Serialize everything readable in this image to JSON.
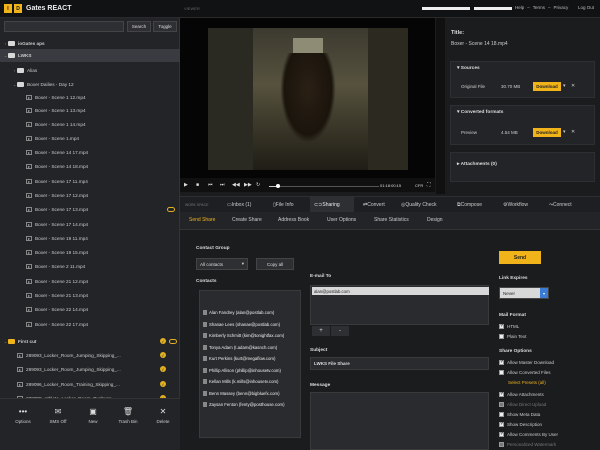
{
  "app": {
    "logo_letters": "I D",
    "name": "Gates REACT",
    "viewer_label": "VIEWER"
  },
  "toplinks": [
    "Help",
    "–",
    "Terms",
    "–",
    "Privacy"
  ],
  "logout": "Log Out",
  "sidebar": {
    "search_button": "Search",
    "toggle_button": "Toggle",
    "tree": [
      {
        "label": "ioGates aps",
        "type": "folder",
        "level": 0
      },
      {
        "label": "LWKS",
        "type": "folder",
        "level": 0
      },
      {
        "label": "Alias",
        "type": "folder",
        "level": 1
      },
      {
        "label": "Boxer Dailies - Day 12",
        "type": "folder",
        "level": 1
      },
      {
        "label": "Boxer - Scene 1 12.mp4",
        "type": "clip",
        "level": 2
      },
      {
        "label": "Boxer - Scene 1 13.mp4",
        "type": "clip",
        "level": 2
      },
      {
        "label": "Boxer - Scene 1 14.mp4",
        "type": "clip",
        "level": 2
      },
      {
        "label": "Boxer - Scene 1.mp4",
        "type": "clip",
        "level": 2
      },
      {
        "label": "Boxer - Scene 14 17.mp4",
        "type": "clip",
        "level": 2
      },
      {
        "label": "Boxer - Scene 14 18.mp4",
        "type": "clip",
        "level": 2
      },
      {
        "label": "Boxer - Scene 17 11.mp4",
        "type": "clip",
        "level": 2
      },
      {
        "label": "Boxer - Scene 17 12.mp4",
        "type": "clip",
        "level": 2
      },
      {
        "label": "Boxer - Scene 17 13.mp4",
        "type": "clip",
        "level": 2
      },
      {
        "label": "Boxer - Scene 17 14.mp4",
        "type": "clip",
        "level": 2
      },
      {
        "label": "Boxer - Scene 19 11.mp4",
        "type": "clip",
        "level": 2
      },
      {
        "label": "Boxer - Scene 19 15.mp4",
        "type": "clip",
        "level": 2
      },
      {
        "label": "Boxer - Scene 2 11.mp4",
        "type": "clip",
        "level": 2
      },
      {
        "label": "Boxer - Scene 21 12.mp4",
        "type": "clip",
        "level": 2
      },
      {
        "label": "Boxer - Scene 21 13.mp4",
        "type": "clip",
        "level": 2
      },
      {
        "label": "Boxer - Scene 22 14.mp4",
        "type": "clip",
        "level": 2
      },
      {
        "label": "Boxer - Scene 22 17.mp4",
        "type": "clip",
        "level": 2
      },
      {
        "label": "First cut",
        "type": "folder",
        "level": 0
      },
      {
        "label": "289093_Locker_Room_Jumping_Skipping_...",
        "type": "clip",
        "level": 1
      },
      {
        "label": "289093_Locker_Room_Jumping_Skipping_...",
        "type": "clip",
        "level": 1
      },
      {
        "label": "289096_Locker_Room_Training_Skipping_...",
        "type": "clip",
        "level": 1
      },
      {
        "label": "289098_Athlete_Locker_Room_Pushups_...",
        "type": "clip",
        "level": 1
      },
      {
        "label": "Colour Correction (Rendered)",
        "type": "clip",
        "level": 1
      },
      {
        "label": "FromMatt",
        "type": "folder",
        "level": 1
      }
    ],
    "bottom": [
      {
        "icon": "more-icon",
        "label": "Options"
      },
      {
        "icon": "sms-icon",
        "label": "SMS Off"
      },
      {
        "icon": "new-folder-icon",
        "label": "New"
      },
      {
        "icon": "trash-icon",
        "label": "Trash Bin"
      },
      {
        "icon": "close-icon",
        "label": "Delete"
      }
    ]
  },
  "player": {
    "timecode": "01:18:00:15",
    "rate": "CFR",
    "progress": 0.08
  },
  "details": {
    "title_label": "Title:",
    "title": "Boxer - Scene 14 18.mp4",
    "sources_header": "Sources",
    "original_label": "Original File",
    "original_size": "30.70 MB",
    "download_label": "Download",
    "converted_header": "Converted formats",
    "preview_label": "Preview",
    "preview_size": "4.54 MB",
    "attachments_header": "Attachments (0)"
  },
  "workspace_label": "WORK SPACE",
  "tabs": [
    "Inbox (1)",
    "File Info",
    "Sharing",
    "Convert",
    "Quality Check",
    "Compose",
    "Workflow",
    "Connect"
  ],
  "subtabs": [
    "Send Share",
    "Create Share",
    "Address Book",
    "User Options",
    "Share Statistics",
    "Design"
  ],
  "share": {
    "contact_group_label": "Contact Group",
    "contact_group_value": "All contacts",
    "copy_all": "Copy all",
    "contacts_label": "Contacts",
    "contacts": [
      "Alan Fandrey (alan@postlab.com)",
      "Shanae Lees (shanae@postlab.com)",
      "Kimberly Schmitt (kim@tonightfax.com)",
      "Tonya Adam (t.adam@kasnch.com)",
      "Kurt Perkins (kurt@megaflow.com)",
      "Phillip Allison (phillip@inhousetv.com)",
      "Kellan Mills (k.mills@inhousetv.com)",
      "Benn Massey (benn@bigbluefx.com)",
      "Zaysan Fenton (fenty@posthouse.com)"
    ],
    "email_to_label": "E-mail To",
    "email_chip": "alan@postlab.com",
    "plus": "+",
    "minus": "-",
    "subject_label": "Subject",
    "subject_value": "LWKS File Share",
    "message_label": "Message",
    "send_button": "Send",
    "link_expires_label": "Link Expires",
    "link_expires_value": "Never",
    "mail_format_label": "Mail Format",
    "format_html": "HTML",
    "format_plain": "Plain Text",
    "share_options_label": "Share Options",
    "opt_master": "Allow Master Download",
    "opt_converted": "Allow Converted Files",
    "select_presets": "Select Presets (all)",
    "opt_attachments": "Allow Attachments",
    "opt_direct_upload": "Allow Direct Upload",
    "opt_meta": "Show Meta Data",
    "opt_description": "Show Description",
    "opt_comments": "Allow Comments By User",
    "opt_watermark": "Personalized Watermark"
  },
  "colors": {
    "accent": "#f0b31a",
    "background": "#1b1c1e",
    "panel": "#232427"
  }
}
